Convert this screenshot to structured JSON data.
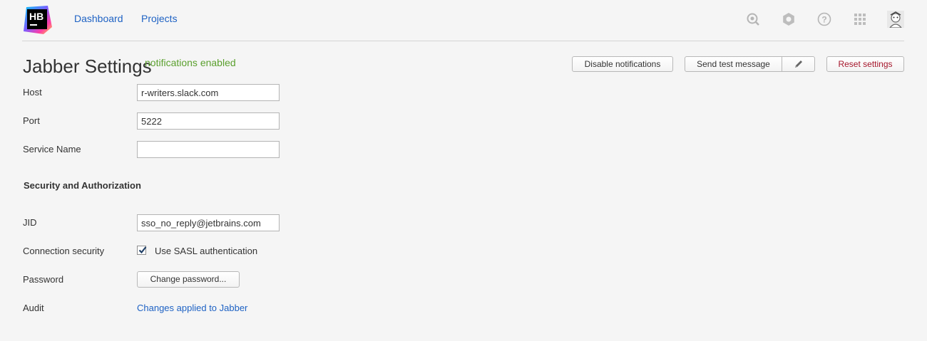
{
  "app": {
    "logo_text": "HB",
    "nav": [
      {
        "label": "Dashboard"
      },
      {
        "label": "Projects"
      }
    ],
    "header_icons": [
      "search-icon",
      "settings-gear-icon",
      "help-icon",
      "apps-grid-icon",
      "user-avatar-icon"
    ]
  },
  "page": {
    "title": "Jabber Settings",
    "status": "notifications enabled",
    "buttons": {
      "disable": "Disable notifications",
      "send_test": "Send test message",
      "edit_icon": "pencil-icon",
      "reset": "Reset settings"
    }
  },
  "form": {
    "host": {
      "label": "Host",
      "value": "r-writers.slack.com"
    },
    "port": {
      "label": "Port",
      "value": "5222"
    },
    "service_name": {
      "label": "Service Name",
      "value": ""
    },
    "section_title": "Security and Authorization",
    "jid": {
      "label": "JID",
      "value": "sso_no_reply@jetbrains.com"
    },
    "connection_security": {
      "label": "Connection security",
      "checkbox_label": "Use SASL authentication",
      "checked": true
    },
    "password": {
      "label": "Password",
      "button": "Change password..."
    },
    "audit": {
      "label": "Audit",
      "link": "Changes applied to Jabber"
    }
  },
  "colors": {
    "link": "#1e62c4",
    "status": "#5ba02e",
    "reset": "#a5162b",
    "background": "#f5f5f5"
  }
}
